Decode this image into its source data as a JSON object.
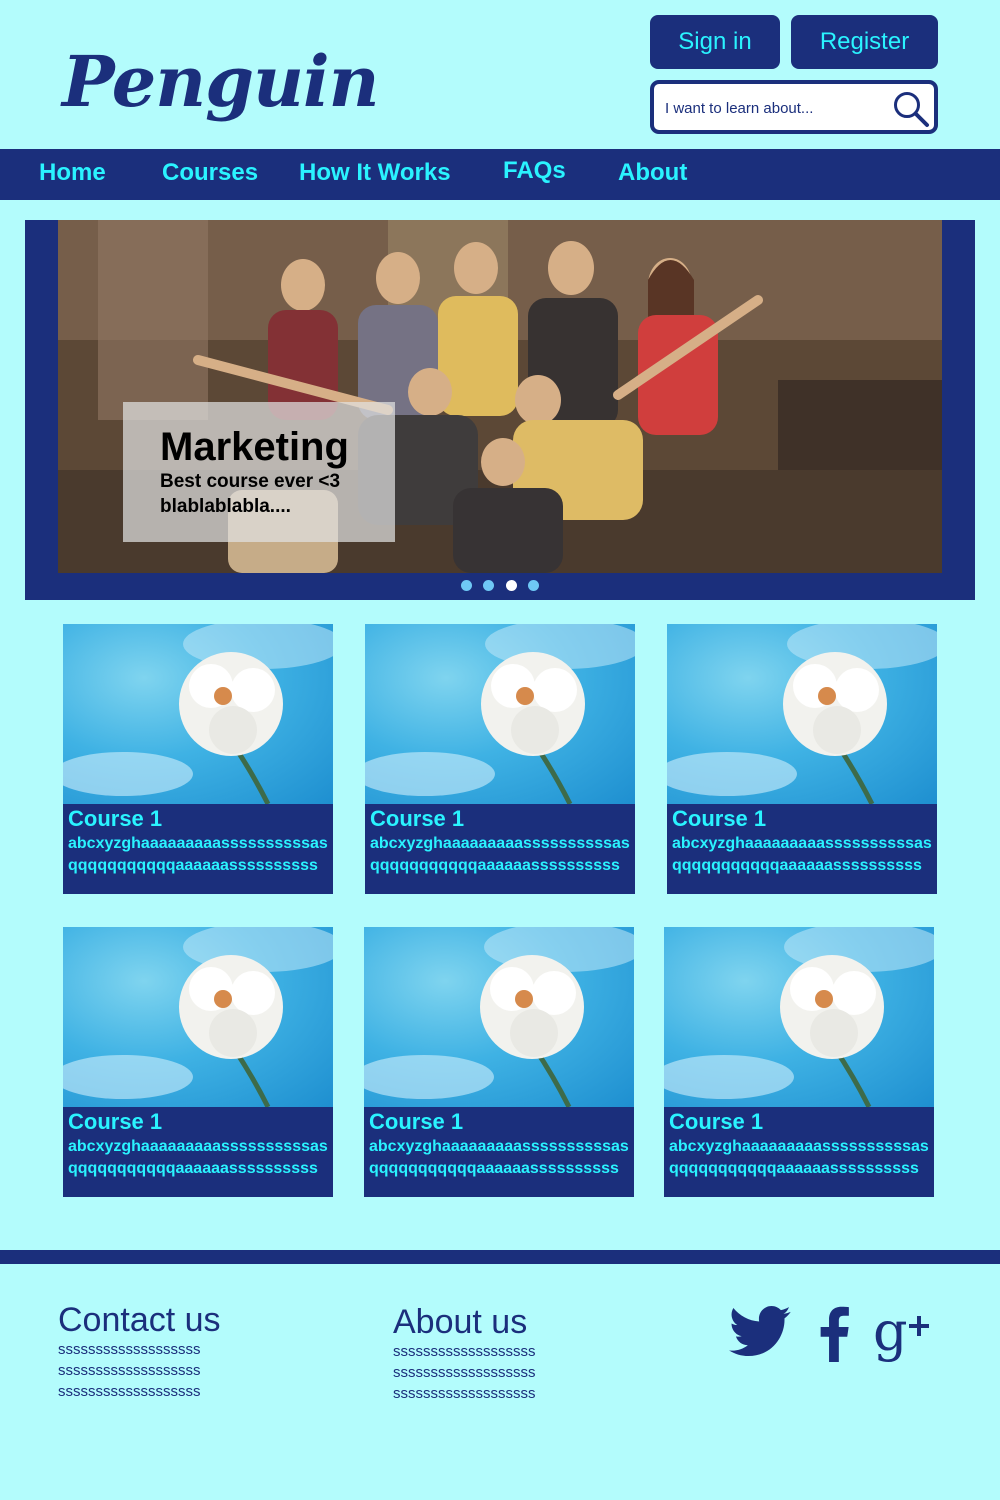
{
  "header": {
    "logo_text": "Penguin",
    "sign_in_label": "Sign in",
    "register_label": "Register",
    "search_placeholder": "I want to learn about...",
    "search_icon": "magnifier"
  },
  "nav": {
    "items": [
      {
        "label": "Home"
      },
      {
        "label": "Courses"
      },
      {
        "label": "How It Works"
      },
      {
        "label": "FAQs"
      },
      {
        "label": "About"
      }
    ]
  },
  "hero": {
    "title": "Marketing",
    "subtitle_line1": "Best course ever <3",
    "subtitle_line2": "blablablabla....",
    "slide_count": 4,
    "active_slide": 3
  },
  "courses": [
    {
      "title": "Course 1",
      "description": "abcxyzghaaaaaaaaassssssssssasqqqqqqqqqqqaaaaaassssssssss"
    },
    {
      "title": "Course 1",
      "description": "abcxyzghaaaaaaaaassssssssssasqqqqqqqqqqqaaaaaassssssssss"
    },
    {
      "title": "Course 1",
      "description": "abcxyzghaaaaaaaaassssssssssasqqqqqqqqqqqaaaaaassssssssss"
    },
    {
      "title": "Course 1",
      "description": "abcxyzghaaaaaaaaassssssssssasqqqqqqqqqqqaaaaaassssssssss"
    },
    {
      "title": "Course 1",
      "description": "abcxyzghaaaaaaaaassssssssssasqqqqqqqqqqqaaaaaassssssssss"
    },
    {
      "title": "Course 1",
      "description": "abcxyzghaaaaaaaaassssssssssasqqqqqqqqqqqaaaaaassssssssss"
    }
  ],
  "footer": {
    "contact_heading": "Contact us",
    "contact_lines": [
      "sssssssssssssssssss",
      "sssssssssssssssssss",
      "sssssssssssssssssss"
    ],
    "about_heading": "About us",
    "about_lines": [
      "sssssssssssssssssss",
      "sssssssssssssssssss",
      "sssssssssssssssssss"
    ],
    "social_icons": [
      "twitter-icon",
      "facebook-icon",
      "google-plus-icon"
    ]
  },
  "colors": {
    "background": "#b3fcfc",
    "primary": "#1b2f7c",
    "accent": "#2af3ff"
  }
}
